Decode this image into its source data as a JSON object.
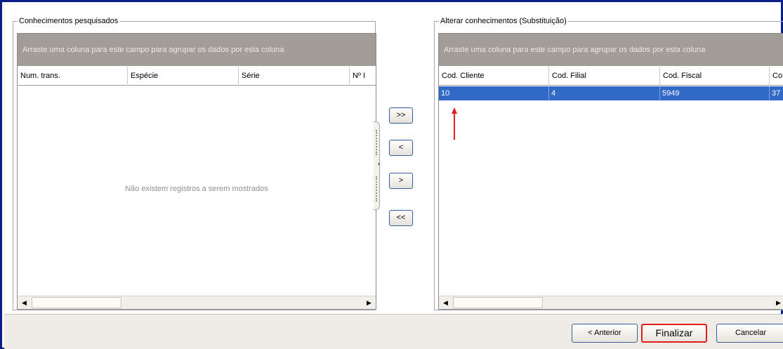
{
  "left_panel": {
    "title": "Conhecimentos pesquisados",
    "group_hint": "Arraste uma coluna para este campo para agrupar os dados por esta coluna",
    "columns": [
      "Num. trans.",
      "Espécie",
      "Série",
      "Nº I"
    ],
    "empty_message": "Não existem registros a serem mostrados"
  },
  "right_panel": {
    "title": "Alterar conhecimentos (Substituição)",
    "group_hint": "Arraste uma coluna para este campo para agrupar os dados por esta coluna",
    "columns": [
      "Cod. Cliente",
      "Cod. Filial",
      "Cod. Fiscal",
      "Co"
    ],
    "rows": [
      [
        "10",
        "4",
        "5949",
        "37"
      ]
    ]
  },
  "transfer_buttons": {
    "move_all_right": ">>",
    "move_left": "<",
    "move_right": ">",
    "move_all_left": "<<"
  },
  "footer": {
    "previous_label": "< Anterior",
    "finish_label": "Finalizar",
    "cancel_label": "Cancelar"
  },
  "colors": {
    "window_border": "#0a1f86",
    "selection": "#3169c6",
    "highlight_annotation": "#e01e1e",
    "group_panel": "#a29e97"
  }
}
